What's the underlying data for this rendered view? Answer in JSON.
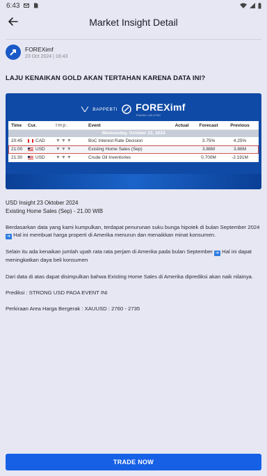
{
  "status": {
    "time": "6:43"
  },
  "appbar": {
    "title": "Market Insight Detail"
  },
  "author": {
    "name": "FOREXimf",
    "date": "23 Oct 2024 | 16:43"
  },
  "headline": "LAJU KENAIKAN GOLD AKAN TERTAHAN KARENA DATA INI?",
  "banner": {
    "bappebti": "BAPPEBTI",
    "brand": "FOREXimf",
    "tagline": "TRADING LIKE A PRO",
    "calendar": {
      "headers": [
        "Time",
        "Cur.",
        "Imp.",
        "Event",
        "Actual",
        "Forecast",
        "Previous"
      ],
      "day": "Wednesday, October 23, 2024",
      "rows": [
        {
          "time": "20:45",
          "cur": "CAD",
          "imp": "▼▼▼",
          "event": "BoC Interest Rate Decision",
          "actual": "",
          "forecast": "3.75%",
          "previous": "4.25%"
        },
        {
          "time": "21:00",
          "cur": "USD",
          "imp": "▼▼▼",
          "event": "Existing Home Sales (Sep)",
          "actual": "",
          "forecast": "3.88M",
          "previous": "3.86M"
        },
        {
          "time": "21:30",
          "cur": "USD",
          "imp": "▼▼▼",
          "event": "Crude Oil Inventories",
          "actual": "",
          "forecast": "0.700M",
          "previous": "-2.191M"
        }
      ]
    }
  },
  "article": {
    "title": "USD Insight 23 Oktober 2024",
    "subtitle": "Existing Home Sales (Sep) - 21.00 WIB",
    "p1a": "Berdasarkan data yang kami kumpulkan, terdapat penurunan suku bunga hipotek di bulan September 2024",
    "p1b": "Hal ini membuat harga properti di Amerika menurun dan menaikkan minat konsumen.",
    "p2a": "Selain itu ada kenaikan jumlah upah rata rata perjam di Amerika pada bulan September",
    "p2b": "Hal ini dapat meningkatkan daya beli konsumen",
    "p3": "Dari data di atas dapat disimpulkan bahwa Existing Home Sales di Amerika diprediksi akan naik nilainya.",
    "p4": "Prediksi : STRONG USD PADA EVENT INI",
    "p5": "Perkiraan Area Harga Bergerak : XAUUSD : 2760 - 2735"
  },
  "cta": {
    "label": "TRADE NOW"
  }
}
